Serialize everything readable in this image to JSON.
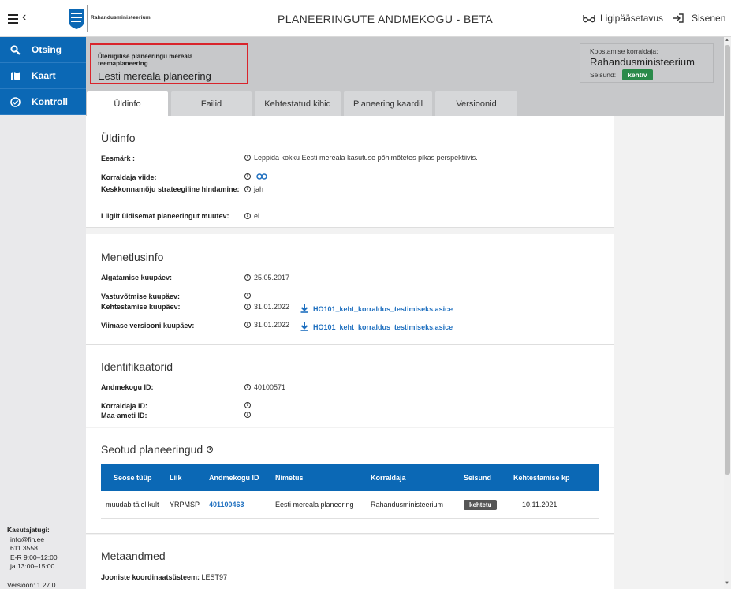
{
  "header": {
    "logo_text": "Rahandusministeerium",
    "title": "PLANEERINGUTE ANDMEKOGU - BETA",
    "accessibility_label": "Ligipääsetavus",
    "login_label": "Sisenen"
  },
  "sidebar": {
    "items": [
      {
        "label": "Otsing",
        "icon": "search-icon"
      },
      {
        "label": "Kaart",
        "icon": "map-icon"
      },
      {
        "label": "Kontroll",
        "icon": "check-circle-icon"
      }
    ],
    "contact_title": "Kasutajatugi:",
    "contact_lines": [
      "info@fin.ee",
      "611 3558",
      "E-R 9:00–12:00",
      "ja 13:00–15:00"
    ],
    "version": "Versioon: 1.27.0"
  },
  "plan": {
    "type": "Üleriigilise planeeringu mereala teemaplaneering",
    "name": "Eesti mereala planeering"
  },
  "coordinator": {
    "label": "Koostamise korraldaja:",
    "name": "Rahandusministeerium",
    "status_label": "Seisund:",
    "status": "kehtiv",
    "status_color": "#2a8a4a"
  },
  "tabs": [
    {
      "label": "Üldinfo",
      "active": true
    },
    {
      "label": "Failid",
      "active": false
    },
    {
      "label": "Kehtestatud kihid",
      "active": false
    },
    {
      "label": "Planeering kaardil",
      "active": false
    },
    {
      "label": "Versioonid",
      "active": false
    }
  ],
  "general": {
    "title": "Üldinfo",
    "goal_label": "Eesmärk :",
    "goal_value": "Leppida kokku Eesti mereala kasutuse põhimõtetes pikas perspektiivis.",
    "coord_ref_label": "Korraldaja viide:",
    "sea_label": "Keskkonnamõju strateegiline hindamine:",
    "sea_value": "jah",
    "changes_label": "Liigilt üldisemat planeeringut muutev:",
    "changes_value": "ei"
  },
  "procedure": {
    "title": "Menetlusinfo",
    "initiation_label": "Algatamise kuupäev:",
    "initiation_value": "25.05.2017",
    "adoption_label": "Vastuvõtmise kuupäev:",
    "approval_label": "Kehtestamise kuupäev:",
    "approval_value": "31.01.2022",
    "approval_file": "HO101_keht_korraldus_testimiseks.asice",
    "last_version_label": "Viimase versiooni kuupäev:",
    "last_version_value": "31.01.2022",
    "last_version_file": "HO101_keht_korraldus_testimiseks.asice"
  },
  "identifiers": {
    "title": "Identifikaatorid",
    "db_id_label": "Andmekogu ID:",
    "db_id_value": "40100571",
    "coord_id_label": "Korraldaja ID:",
    "land_id_label": "Maa-ameti ID:"
  },
  "related": {
    "title": "Seotud planeeringud",
    "columns": [
      "Seose tüüp",
      "Liik",
      "Andmekogu ID",
      "Nimetus",
      "Korraldaja",
      "Seisund",
      "Kehtestamise kp"
    ],
    "rows": [
      {
        "relation": "muudab täielikult",
        "kind": "YRPMSP",
        "id": "401100463",
        "name": "Eesti mereala planeering",
        "coordinator": "Rahandusministeerium",
        "status": "kehtetu",
        "date": "10.11.2021"
      }
    ]
  },
  "meta": {
    "title": "Metaandmed",
    "crs_label": "Jooniste koordinaatsüsteem:",
    "crs_value": "LEST97"
  }
}
